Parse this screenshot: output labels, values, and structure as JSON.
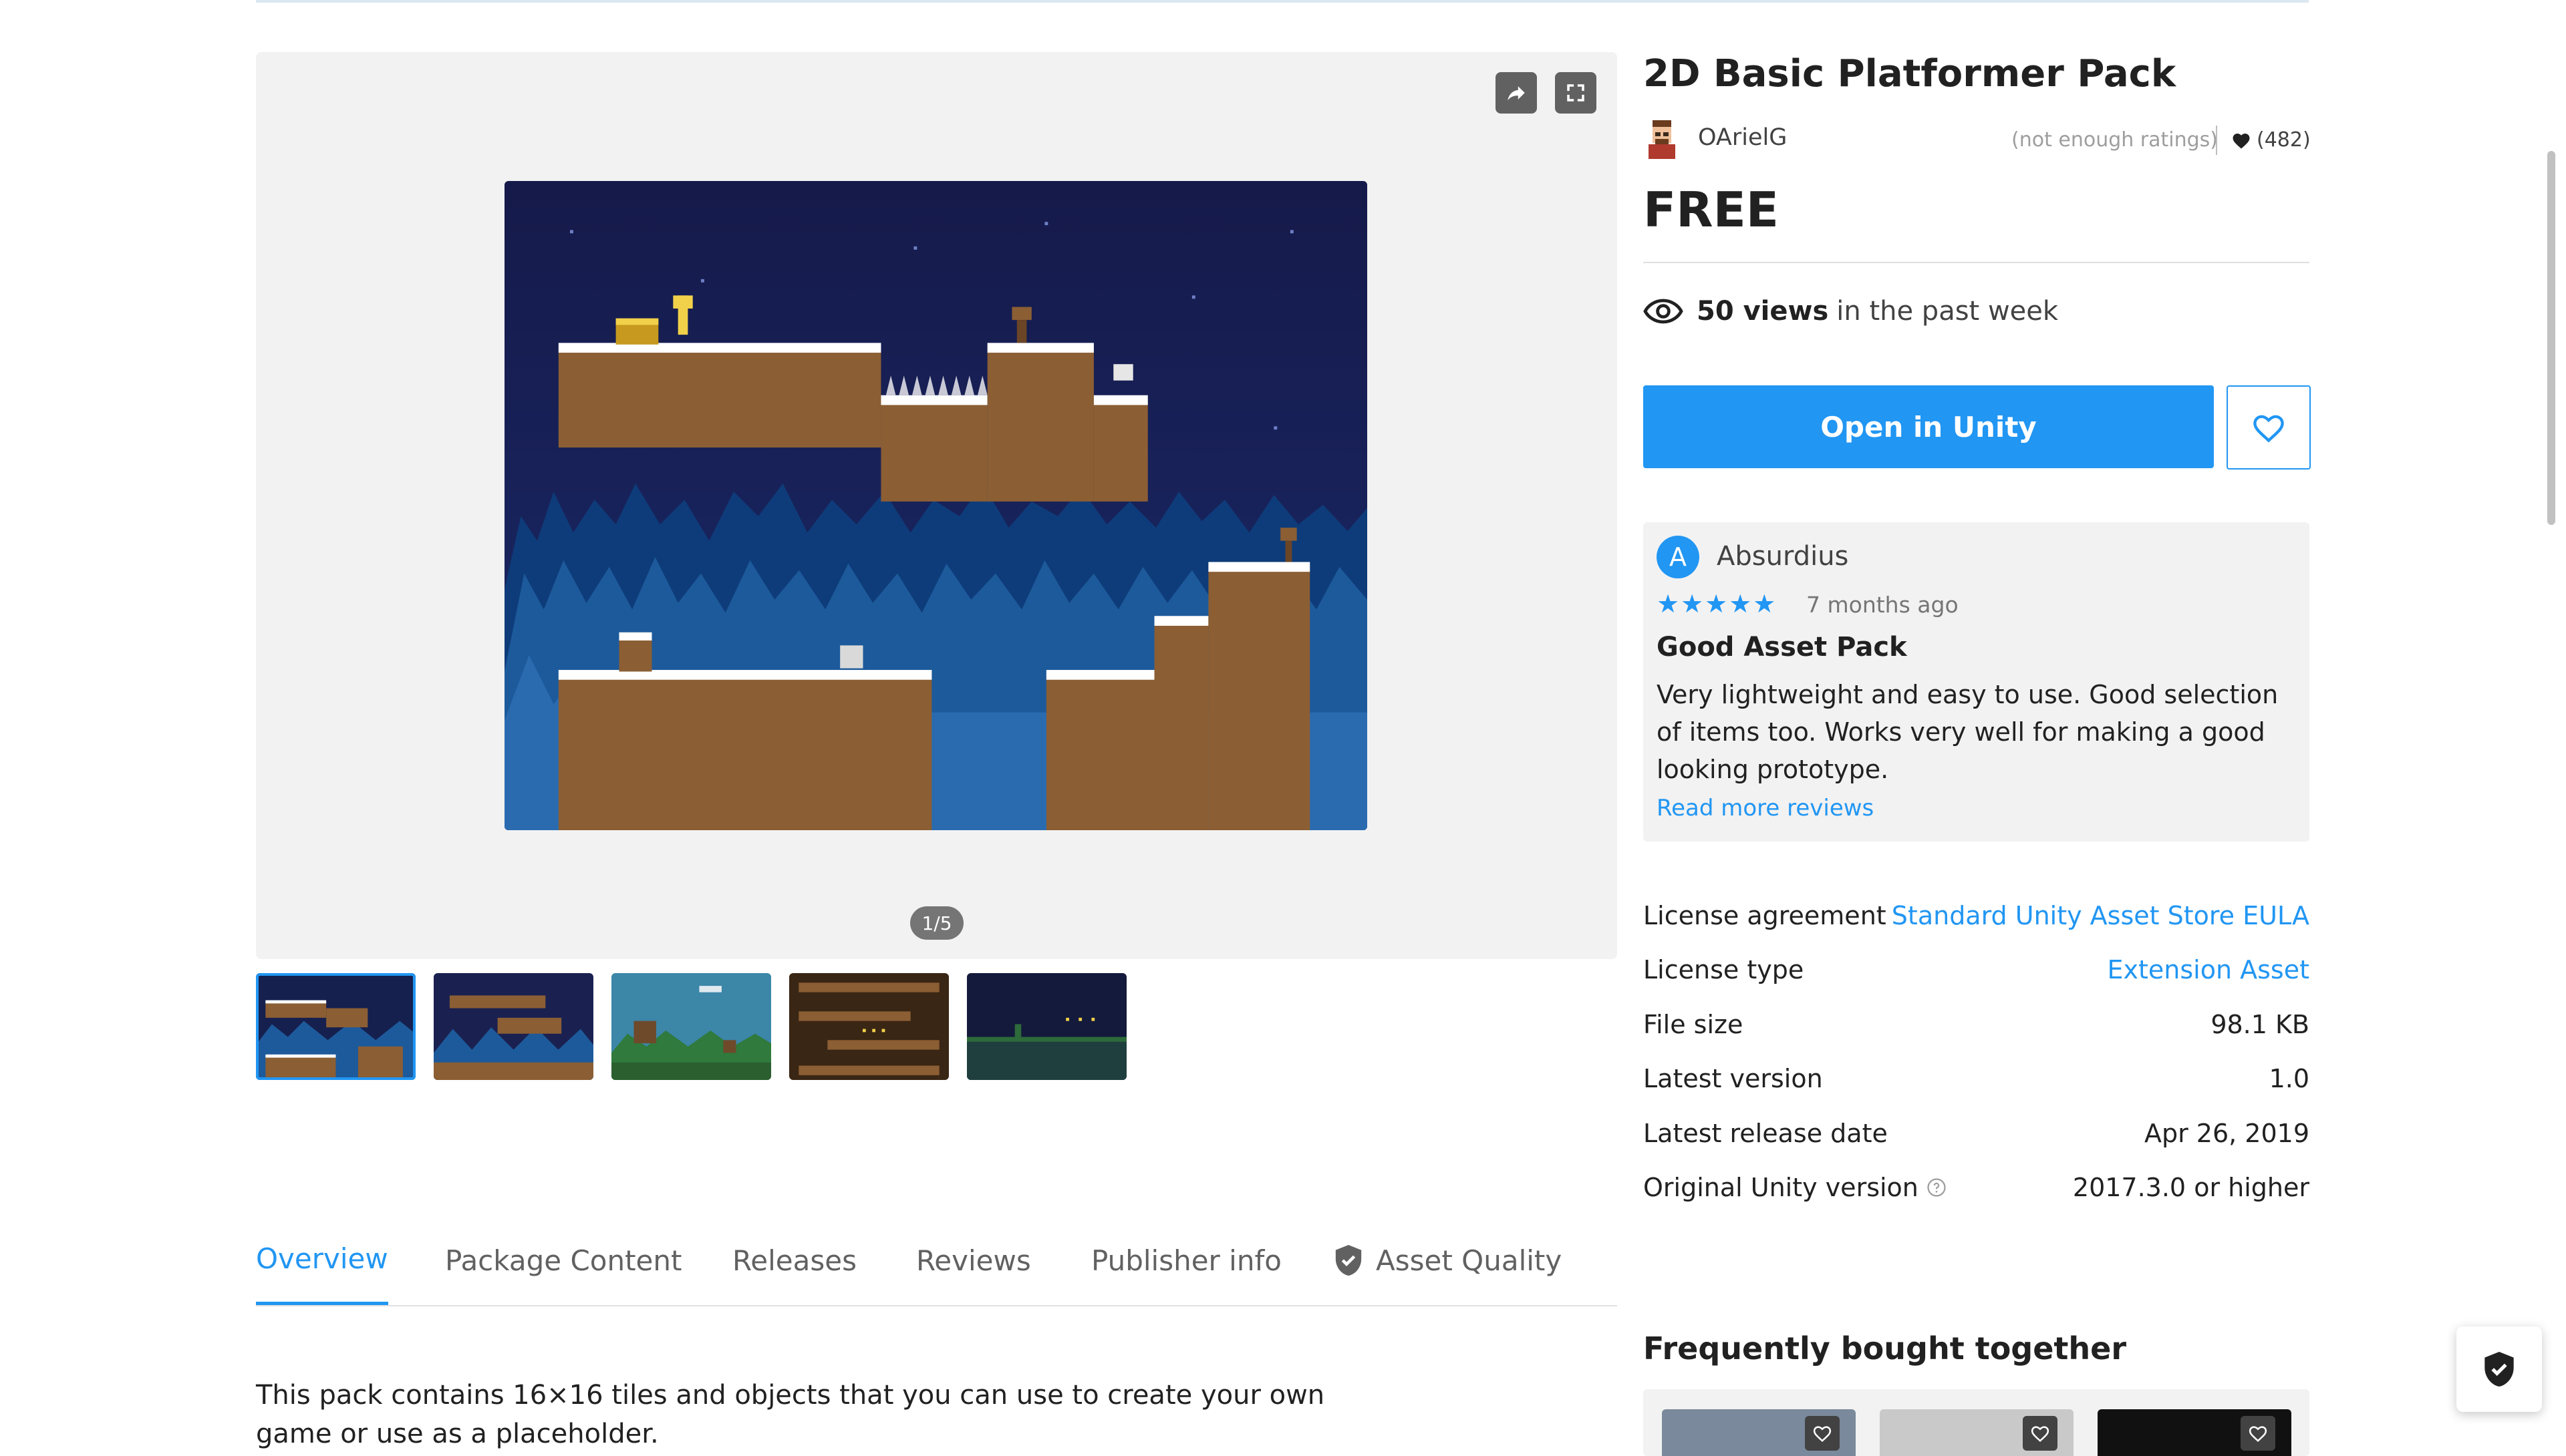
{
  "product": {
    "title": "2D Basic Platformer Pack",
    "publisher": "OArielG",
    "ratings_note": "(not enough ratings)",
    "favorites": "(482)",
    "price": "FREE",
    "views_count": "50 views",
    "views_suffix": "in the past week",
    "open_button": "Open in Unity",
    "wishlist_icon": "heart-outline-icon"
  },
  "gallery": {
    "counter": "1/5",
    "share_icon": "share-icon",
    "fullscreen_icon": "fullscreen-icon",
    "thumbnail_count": 5
  },
  "review": {
    "avatar_letter": "A",
    "author": "Absurdius",
    "stars": "★★★★★",
    "date": "7 months ago",
    "title": "Good Asset Pack",
    "body": "Very lightweight and easy to use. Good selection of items too. Works very well for making a good looking prototype.",
    "read_more": "Read more reviews"
  },
  "details": [
    {
      "label": "License agreement",
      "value": "Standard Unity Asset Store EULA",
      "link": true
    },
    {
      "label": "License type",
      "value": "Extension Asset",
      "link": true
    },
    {
      "label": "File size",
      "value": "98.1 KB",
      "link": false
    },
    {
      "label": "Latest version",
      "value": "1.0",
      "link": false
    },
    {
      "label": "Latest release date",
      "value": "Apr 26, 2019",
      "link": false
    },
    {
      "label": "Original Unity version",
      "value": "2017.3.0 or higher",
      "link": false,
      "help": true
    }
  ],
  "tabs": [
    "Overview",
    "Package Content",
    "Releases",
    "Reviews",
    "Publisher info",
    "Asset Quality"
  ],
  "description": "This pack contains 16×16 tiles and objects that you can use to create your own game or use as a placeholder.",
  "frequently_bought": {
    "heading": "Frequently bought together"
  },
  "colors": {
    "accent": "#2196f3",
    "night_sky": "#161c4f",
    "ground": "#8b5e34",
    "snow": "#ffffff",
    "trees": "#1d5a9b"
  }
}
